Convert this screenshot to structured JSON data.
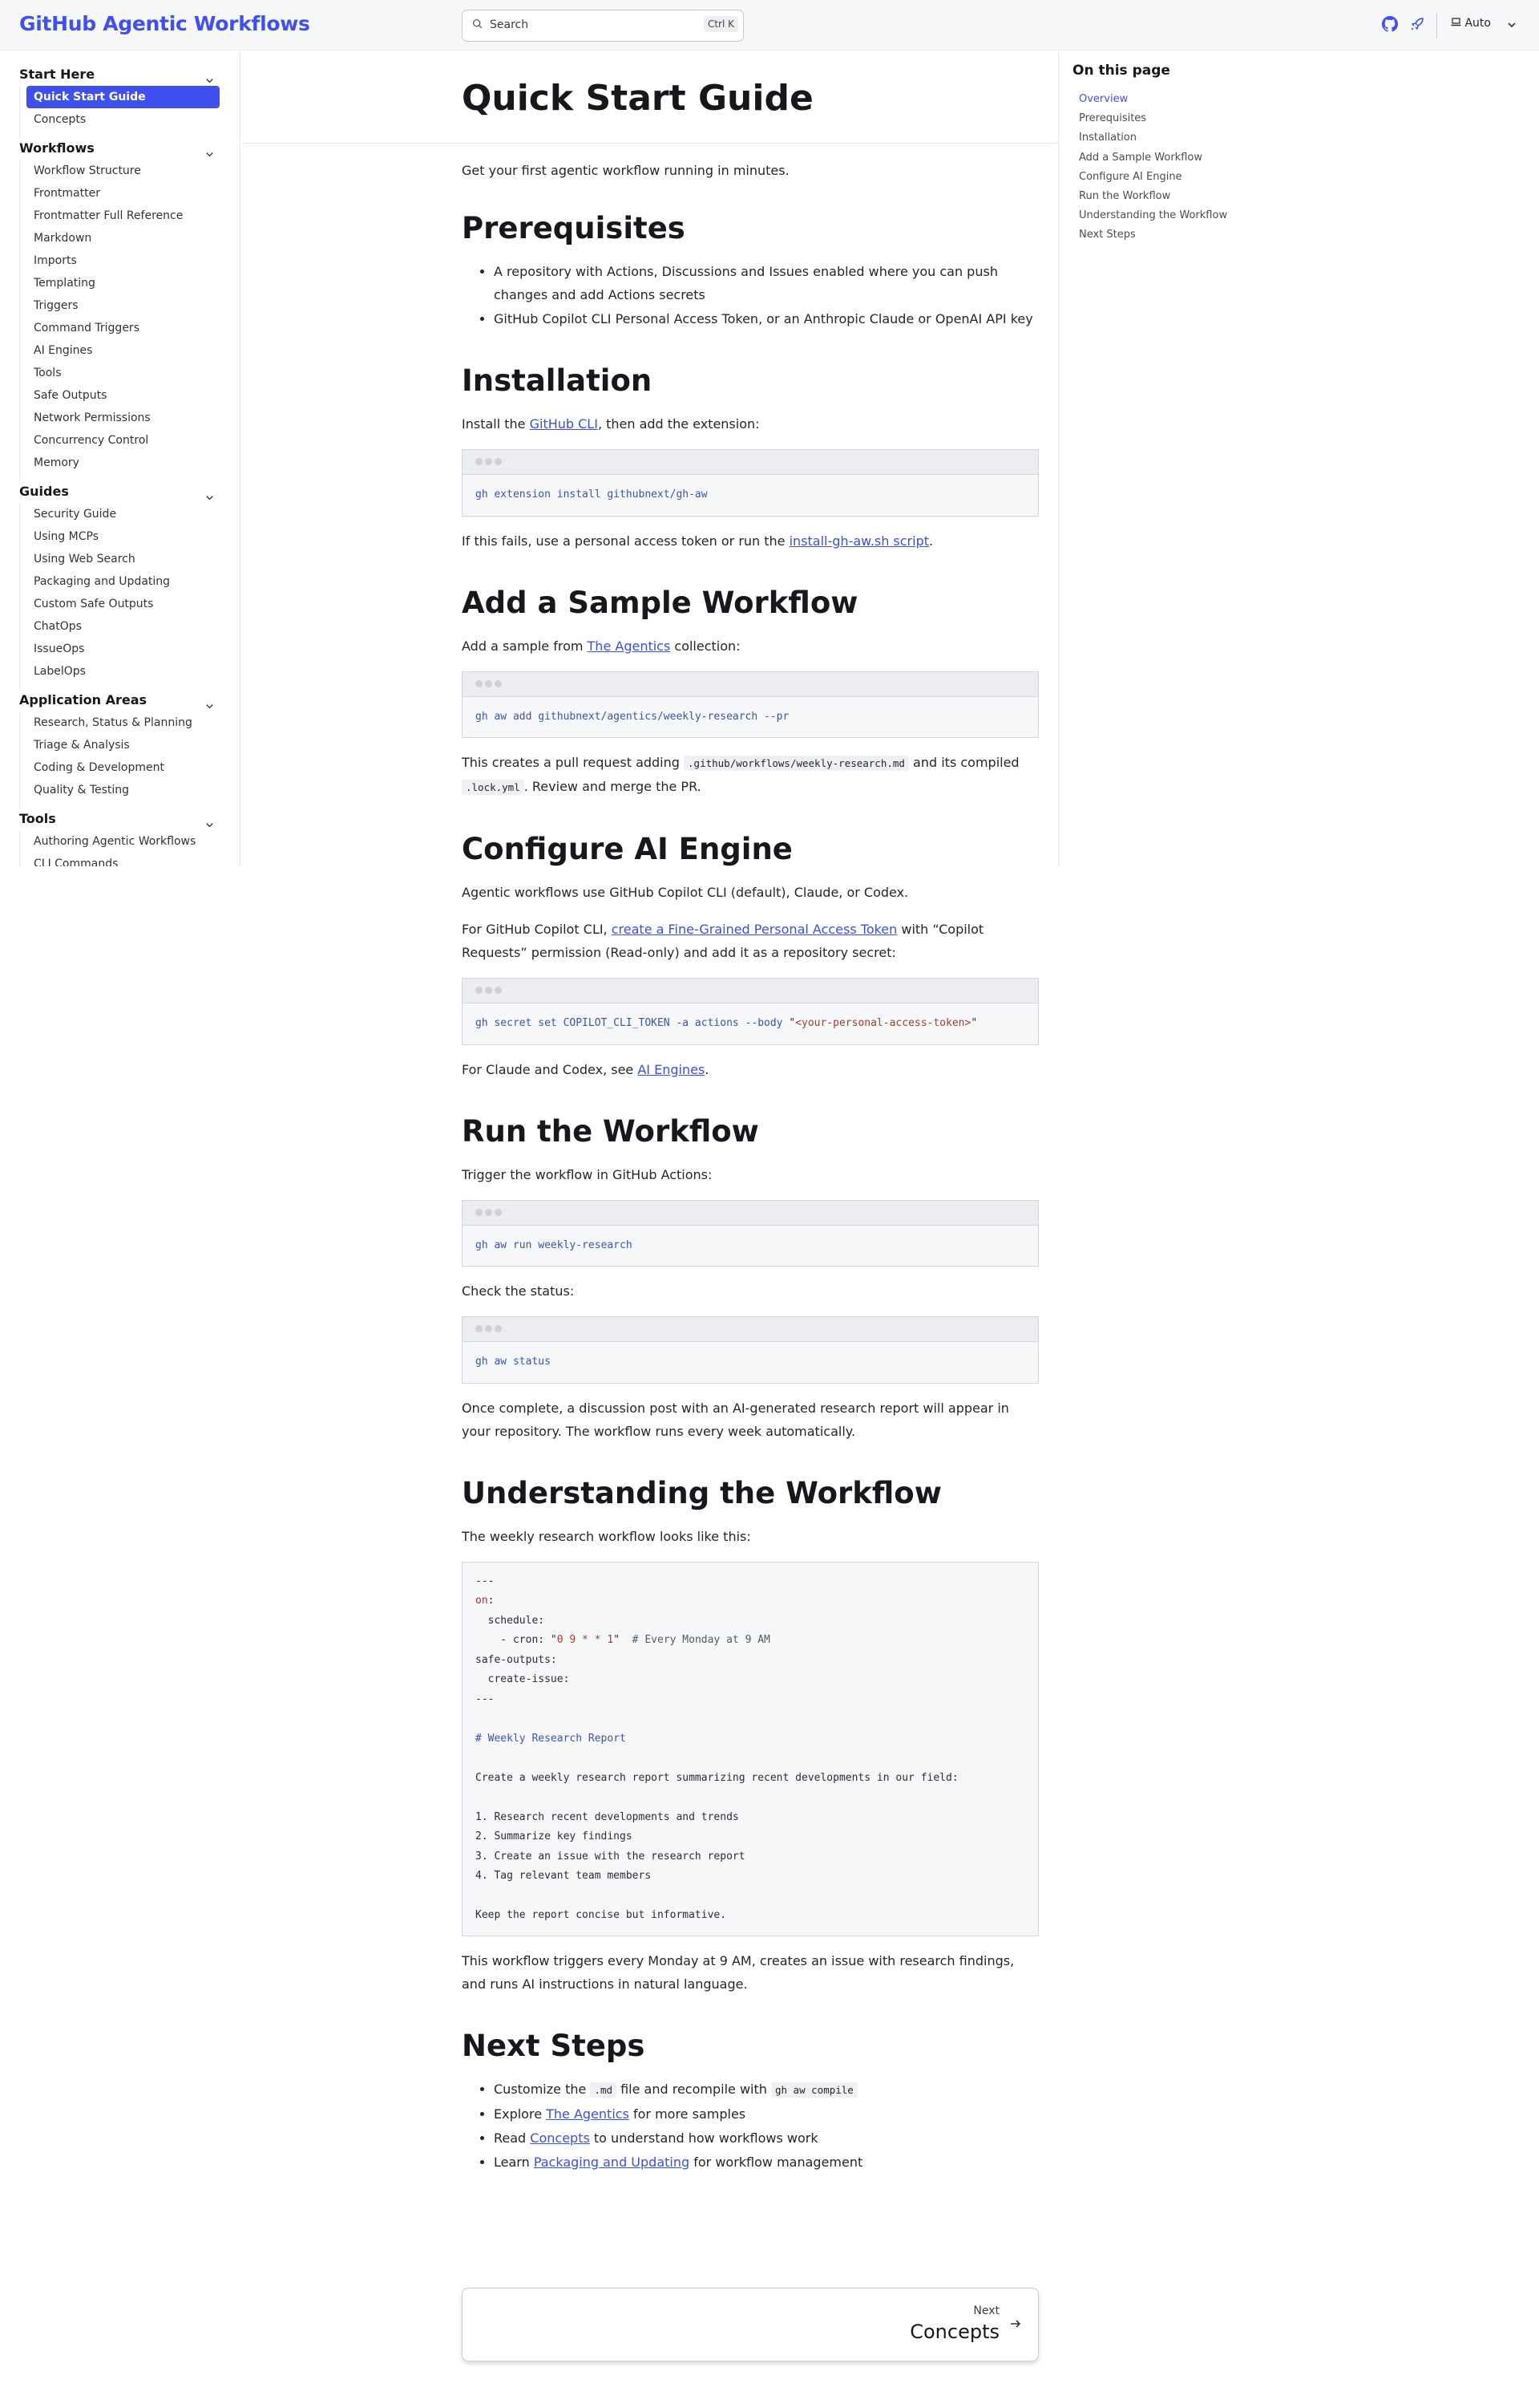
{
  "header": {
    "brand": "GitHub Agentic Workflows",
    "search_placeholder": "Search",
    "search_shortcut": "Ctrl K",
    "theme_label": "Auto",
    "accent": "#4050ee"
  },
  "sidebar": {
    "sections": [
      {
        "label": "Start Here",
        "items": [
          "Quick Start Guide",
          "Concepts"
        ],
        "active": 0
      },
      {
        "label": "Workflows",
        "items": [
          "Workflow Structure",
          "Frontmatter",
          "Frontmatter Full Reference",
          "Markdown",
          "Imports",
          "Templating",
          "Triggers",
          "Command Triggers",
          "AI Engines",
          "Tools",
          "Safe Outputs",
          "Network Permissions",
          "Concurrency Control",
          "Memory"
        ]
      },
      {
        "label": "Guides",
        "items": [
          "Security Guide",
          "Using MCPs",
          "Using Web Search",
          "Packaging and Updating",
          "Custom Safe Outputs",
          "ChatOps",
          "IssueOps",
          "LabelOps"
        ]
      },
      {
        "label": "Application Areas",
        "items": [
          "Research, Status & Planning",
          "Triage & Analysis",
          "Coding & Development",
          "Quality & Testing"
        ]
      },
      {
        "label": "Tools",
        "items": [
          "Authoring Agentic Workflows",
          "CLI Commands"
        ]
      }
    ]
  },
  "toc": {
    "heading": "On this page",
    "items": [
      "Overview",
      "Prerequisites",
      "Installation",
      "Add a Sample Workflow",
      "Configure AI Engine",
      "Run the Workflow",
      "Understanding the Workflow",
      "Next Steps"
    ]
  },
  "page": {
    "title": "Quick Start Guide",
    "intro": "Get your first agentic workflow running in minutes.",
    "prereq": {
      "heading": "Prerequisites",
      "items": [
        "A repository with Actions, Discussions and Issues enabled where you can push changes and add Actions secrets",
        "GitHub Copilot CLI Personal Access Token, or an Anthropic Claude or OpenAI API key"
      ]
    },
    "install": {
      "heading": "Installation",
      "text": [
        {
          "t": "Install the "
        },
        {
          "t": "GitHub CLI",
          "link": true
        },
        {
          "t": ", then add the extension:"
        }
      ],
      "code": [
        [
          {
            "t": "gh extension install githubnext/gh-aw",
            "c": "fn"
          }
        ]
      ],
      "after": [
        {
          "t": "If this fails, use a personal access token or run the "
        },
        {
          "t": "install-gh-aw.sh script",
          "link": true
        },
        {
          "t": "."
        }
      ]
    },
    "sample": {
      "heading": "Add a Sample Workflow",
      "text": [
        {
          "t": "Add a sample from "
        },
        {
          "t": "The Agentics",
          "link": true
        },
        {
          "t": " collection:"
        }
      ],
      "code": [
        [
          {
            "t": "gh aw add githubnext/agentics/weekly-research --pr",
            "c": "fn"
          }
        ]
      ],
      "after": [
        {
          "t": "This creates a pull request adding "
        },
        {
          "t": ".github/workflows/weekly-research.md",
          "code": true
        },
        {
          "t": " and its compiled "
        },
        {
          "t": ".lock.yml",
          "code": true
        },
        {
          "t": ". Review and merge the PR."
        }
      ]
    },
    "engine": {
      "heading": "Configure AI Engine",
      "text1": "Agentic workflows use GitHub Copilot CLI (default), Claude, or Codex.",
      "text2": [
        {
          "t": "For GitHub Copilot CLI, "
        },
        {
          "t": "create a Fine-Grained Personal Access Token",
          "link": true
        },
        {
          "t": " with “Copilot Requests” permission (Read-only) and add it as a repository secret:"
        }
      ],
      "code": [
        [
          {
            "t": "gh secret set COPILOT_CLI_TOKEN -a actions --body ",
            "c": "fn"
          },
          {
            "t": "\"",
            "c": "p"
          },
          {
            "t": "<your-personal-access-token>",
            "c": "str"
          },
          {
            "t": "\"",
            "c": "p"
          }
        ]
      ],
      "after": [
        {
          "t": "For Claude and Codex, see "
        },
        {
          "t": "AI Engines",
          "link": true
        },
        {
          "t": "."
        }
      ]
    },
    "run": {
      "heading": "Run the Workflow",
      "text1": "Trigger the workflow in GitHub Actions:",
      "code1": [
        [
          {
            "t": "gh aw run weekly-research",
            "c": "fn"
          }
        ]
      ],
      "text2": "Check the status:",
      "code2": [
        [
          {
            "t": "gh aw status",
            "c": "fn"
          }
        ]
      ],
      "after": "Once complete, a discussion post with an AI-generated research report will appear in your repository. The workflow runs every week automatically."
    },
    "understand": {
      "heading": "Understanding the Workflow",
      "text": "The weekly research workflow looks like this:",
      "code": [
        [
          {
            "t": "---",
            "c": "p"
          }
        ],
        [
          {
            "t": "on",
            "c": "kw"
          },
          {
            "t": ":",
            "c": "p"
          }
        ],
        [
          {
            "t": "  schedule:",
            "c": "p"
          }
        ],
        [
          {
            "t": "    - cron: ",
            "c": "p"
          },
          {
            "t": "\"",
            "c": "p"
          },
          {
            "t": "0 9 * * 1",
            "c": "str"
          },
          {
            "t": "\"",
            "c": "p"
          },
          {
            "t": "  # Every Monday at 9 AM",
            "c": "cm"
          }
        ],
        [
          {
            "t": "safe-outputs:",
            "c": "p"
          }
        ],
        [
          {
            "t": "  create-issue:",
            "c": "p"
          }
        ],
        [
          {
            "t": "---",
            "c": "p"
          }
        ],
        [
          {
            "t": " ",
            "c": "p"
          }
        ],
        [
          {
            "t": "# Weekly Research Report",
            "c": "hd"
          }
        ],
        [
          {
            "t": " ",
            "c": "p"
          }
        ],
        [
          {
            "t": "Create a weekly research report summarizing recent developments in our field:",
            "c": "p"
          }
        ],
        [
          {
            "t": " ",
            "c": "p"
          }
        ],
        [
          {
            "t": "1. Research recent developments and trends",
            "c": "p"
          }
        ],
        [
          {
            "t": "2. Summarize key findings",
            "c": "p"
          }
        ],
        [
          {
            "t": "3. Create an issue with the research report",
            "c": "p"
          }
        ],
        [
          {
            "t": "4. Tag relevant team members",
            "c": "p"
          }
        ],
        [
          {
            "t": " ",
            "c": "p"
          }
        ],
        [
          {
            "t": "Keep the report concise but informative.",
            "c": "p"
          }
        ]
      ],
      "after": "This workflow triggers every Monday at 9 AM, creates an issue with research findings, and runs AI instructions in natural language."
    },
    "next": {
      "heading": "Next Steps",
      "items": [
        [
          {
            "t": "Customize the "
          },
          {
            "t": ".md",
            "code": true
          },
          {
            "t": " file and recompile with "
          },
          {
            "t": "gh aw compile",
            "code": true
          }
        ],
        [
          {
            "t": "Explore "
          },
          {
            "t": "The Agentics",
            "link": true
          },
          {
            "t": " for more samples"
          }
        ],
        [
          {
            "t": "Read "
          },
          {
            "t": "Concepts",
            "link": true
          },
          {
            "t": " to understand how workflows work"
          }
        ],
        [
          {
            "t": "Learn "
          },
          {
            "t": "Packaging and Updating",
            "link": true
          },
          {
            "t": " for workflow management"
          }
        ]
      ]
    },
    "pager": {
      "label": "Next",
      "title": "Concepts"
    }
  }
}
